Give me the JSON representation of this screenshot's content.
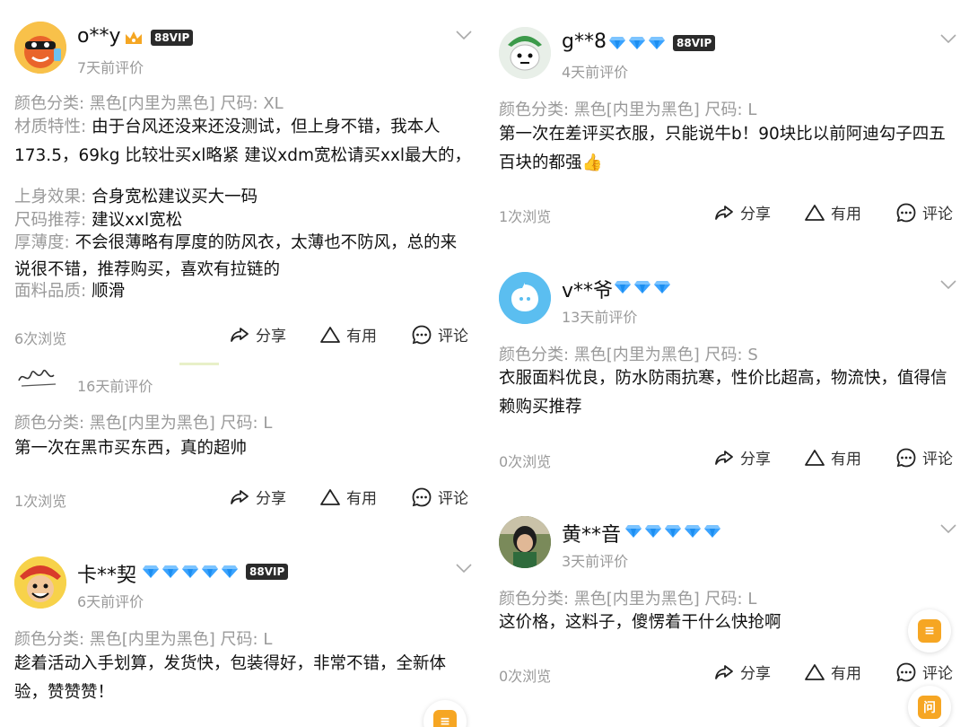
{
  "labels": {
    "share": "分享",
    "useful": "有用",
    "comment": "评论"
  },
  "left_reviews": [
    {
      "username": "o**y",
      "badge": "88VIP",
      "time": "7天前评价",
      "spec": "颜色分类: 黑色[内里为黑色] 尺码: XL",
      "details": [
        {
          "label": "材质特性: ",
          "value": "由于台风还没来还没测试，但上身不错，我本人173.5，69kg 比较壮买xl略紧 建议xdm宽松请买xxl最大的，"
        },
        {
          "label": "上身效果: ",
          "value": "合身宽松建议买大一码"
        },
        {
          "label": "尺码推荐: ",
          "value": "建议xxl宽松"
        },
        {
          "label": "厚薄度: ",
          "value": "不会很薄略有厚度的防风衣，太薄也不防风，总的来说很不错，推荐购买，喜欢有拉链的"
        },
        {
          "label": "面料品质: ",
          "value": "顺滑"
        }
      ],
      "views": "6次浏览"
    },
    {
      "time": "16天前评价",
      "spec": "颜色分类: 黑色[内里为黑色] 尺码: L",
      "text": "第一次在黑市买东西，真的超帅",
      "views": "1次浏览"
    },
    {
      "username": "卡**契",
      "badge": "88VIP",
      "time": "6天前评价",
      "spec": "颜色分类: 黑色[内里为黑色] 尺码: L",
      "text": "趁着活动入手划算，发货快，包装得好，非常不错，全新体验，赞赞赞！"
    }
  ],
  "right_reviews": [
    {
      "username": "g**8",
      "badge": "88VIP",
      "time": "4天前评价",
      "spec": "颜色分类: 黑色[内里为黑色] 尺码: L",
      "text": "第一次在差评买衣服，只能说牛b！90块比以前阿迪勾子四五百块的都强👍",
      "views": "1次浏览"
    },
    {
      "username": "v**爷",
      "time": "13天前评价",
      "spec": "颜色分类: 黑色[内里为黑色] 尺码: S",
      "text": "衣服面料优良，防水防雨抗寒，性价比超高，物流快，值得信赖购买推荐",
      "views": "0次浏览"
    },
    {
      "username": "黄**音",
      "time": "3天前评价",
      "spec": "颜色分类: 黑色[内里为黑色] 尺码: L",
      "text": "这价格，这料子，傻愣着干什么快抢啊",
      "views": "0次浏览"
    }
  ],
  "float_badge_text": "问",
  "colors": {
    "diamond": "#3aa3ff",
    "float": "#f6a623",
    "muted": "#9a9a9a"
  }
}
